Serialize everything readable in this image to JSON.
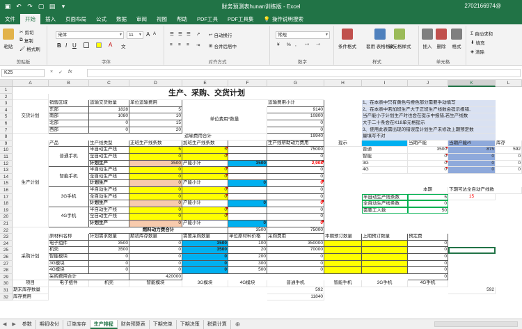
{
  "window": {
    "title": "财务预测表hunan训练版 - Excel",
    "user": "2702166974@",
    "quick_access": [
      "save-icon",
      "undo-icon",
      "redo-icon",
      "new-icon",
      "open-icon",
      "more-icon"
    ]
  },
  "ribbon_tabs": [
    "文件",
    "开始",
    "插入",
    "页面布局",
    "公式",
    "数据",
    "审阅",
    "视图",
    "帮助",
    "PDF工具",
    "PDF工具集",
    "操作说明搜索"
  ],
  "active_tab": "开始",
  "ribbon": {
    "clipboard": {
      "label": "剪贴板",
      "paste": "粘贴",
      "cut": "剪切",
      "copy": "复制",
      "format_painter": "格式刷"
    },
    "font": {
      "label": "字体",
      "name": "宋体",
      "size": "11",
      "grow": "A",
      "shrink": "A",
      "bold": "B",
      "italic": "I",
      "underline": "U",
      "phonetic": "文"
    },
    "alignment": {
      "label": "对齐方式",
      "wrap": "自动换行",
      "merge": "合并后居中"
    },
    "number": {
      "label": "数字",
      "format": "常规",
      "percent": "%",
      "comma": ","
    },
    "styles": {
      "label": "样式",
      "conditional": "条件格式",
      "table": "套用\n表格格式",
      "cell_styles": "单元格样式"
    },
    "cells": {
      "label": "单元格",
      "insert": "插入",
      "delete": "删除",
      "format": "格式"
    },
    "editing": {
      "autosum": "自动求和",
      "fill": "填充",
      "clear": "清除"
    }
  },
  "formula_bar": {
    "name_box": "K25",
    "cancel": "×",
    "enter": "✓",
    "fx": "fx",
    "value": ""
  },
  "columns": [
    "A",
    "B",
    "C",
    "D",
    "E",
    "F",
    "G",
    "H",
    "I",
    "J",
    "K",
    "L"
  ],
  "selected_column": "K",
  "rows": [
    "1",
    "2",
    "3",
    "4",
    "5",
    "6",
    "7",
    "8",
    "9",
    "10",
    "11",
    "12",
    "13",
    "14",
    "15",
    "16",
    "17",
    "18",
    "19",
    "20",
    "21",
    "22",
    "23",
    "24",
    "25",
    "26",
    "27",
    "28",
    "29",
    "30",
    "31",
    "32"
  ],
  "sheet": {
    "title": "生产、采购、交货计划",
    "sections": {
      "delivery": "交货计划",
      "production": "生产计划",
      "procurement": "采购计划"
    },
    "delivery": {
      "headers": [
        "销售区域",
        "运输交货数量",
        "单位运输费用"
      ],
      "rows": [
        {
          "area": "东部",
          "qty": "1828",
          "cost": "5"
        },
        {
          "area": "南部",
          "qty": "1080",
          "cost": "10"
        },
        {
          "area": "北部",
          "qty": "0",
          "cost": "15"
        },
        {
          "area": "西部",
          "qty": "0",
          "cost": "20"
        }
      ],
      "unit_label": "单位费用*数量",
      "subtotal_header": "运输费用小计",
      "subtotals": [
        "9140",
        "10800",
        "0",
        "0"
      ],
      "total_label": "运输费用合计",
      "total": "19940"
    },
    "production": {
      "headers": [
        "产品",
        "生产线类型",
        "正班生产线条数",
        "加班生产线条数",
        "生产线帮助动力费用"
      ],
      "products": [
        {
          "name": "普通手机",
          "lines": [
            {
              "type": "半自动生产线",
              "regular": "5",
              "overtime": "5",
              "power": "75000"
            },
            {
              "type": "全自动生产线",
              "regular": "0",
              "overtime": "0",
              "power": "0"
            }
          ],
          "plan": "3500",
          "sub": "3500",
          "sub2": "2,908"
        },
        {
          "name": "智能手机",
          "lines": [
            {
              "type": "半自动生产线",
              "regular": "0",
              "overtime": "0",
              "power": "0"
            },
            {
              "type": "全自动生产线",
              "regular": "0",
              "overtime": "0",
              "power": "0"
            }
          ],
          "plan": "0",
          "sub": "0",
          "sub2": "0"
        },
        {
          "name": "3G手机",
          "lines": [
            {
              "type": "半自动生产线",
              "regular": "0",
              "overtime": "0",
              "power": "0"
            },
            {
              "type": "全自动生产线",
              "regular": "0",
              "overtime": "0",
              "power": "0"
            }
          ],
          "plan": "0",
          "sub": "0",
          "sub2": "0"
        },
        {
          "name": "4G手机",
          "lines": [
            {
              "type": "半自动生产线",
              "regular": "0",
              "overtime": "0",
              "power": "0"
            },
            {
              "type": "全自动生产线",
              "regular": "0",
              "overtime": "0",
              "power": "0"
            }
          ],
          "plan": "0",
          "sub": "0",
          "sub2": "0"
        }
      ],
      "plan_label": "计划生产",
      "subtotal_label": "产能小计",
      "fuel_total_label": "燃料动力费合计",
      "fuel_total_value": "3500",
      "fuel_total_cost": "75000"
    },
    "procurement": {
      "headers": [
        "原材料名称",
        "计划需求数量",
        "期初库存数量",
        "需要采购数量",
        "单位原材料价格",
        "采购费用",
        "本期预订数量",
        "上期预订数量",
        "预定费"
      ],
      "rows": [
        {
          "name": "电子组件",
          "need": "3500",
          "stock": "0",
          "buy": "3500",
          "price": "100",
          "cost": "350000",
          "pre": "0"
        },
        {
          "name": "机壳",
          "need": "3500",
          "stock": "0",
          "buy": "3500",
          "price": "20",
          "cost": "70000",
          "pre": "0"
        },
        {
          "name": "智能模块",
          "need": "0",
          "stock": "0",
          "buy": "0",
          "price": "200",
          "cost": "0",
          "pre": "0"
        },
        {
          "name": "3G模块",
          "need": "0",
          "stock": "0",
          "buy": "0",
          "price": "300",
          "cost": "0",
          "pre": "0"
        },
        {
          "name": "4G模块",
          "need": "0",
          "stock": "0",
          "buy": "0",
          "price": "500",
          "cost": "0",
          "pre": "0"
        }
      ],
      "total_label": "采购费用合计",
      "total": "420000",
      "total_pre": "0"
    },
    "bottom": {
      "headers": [
        "项目",
        "电子组件",
        "机壳",
        "智能模块",
        "3G模块",
        "4G模块",
        "普通手机",
        "智能手机",
        "3G手机",
        "4G手机"
      ],
      "row31": {
        "label": "期末库存数量",
        "value_g": "592",
        "value_l": "592"
      },
      "row32": {
        "label": "库存费用",
        "value_g": "11840"
      }
    },
    "notes": [
      "1、在本表中只有黄色与橙色部分需要手动填写",
      "2、在本表中若加班生产大于正班生产线数会提示报错,",
      "当产能小于计划生产时也会在提示中报错,若生产线数",
      "大于二十条会在K18单元格提示",
      "3、使用此表需出现的错误是计划生产未修改上期预定数",
      "量填写不对"
    ],
    "prompt_label": "提示",
    "capacity": {
      "header1": "当期产能",
      "header2": "当期产能/4",
      "header3": "库存",
      "rows": [
        {
          "name": "普通",
          "cap": "3500",
          "cap4": "875",
          "stock": "592"
        },
        {
          "name": "智能",
          "cap": "0",
          "cap4": "0",
          "stock": "0"
        },
        {
          "name": "3G",
          "cap": "0",
          "cap4": "0",
          "stock": "0"
        },
        {
          "name": "4G",
          "cap": "0",
          "cap4": "0",
          "stock": "0"
        }
      ]
    },
    "period": {
      "this": "本期",
      "next": "下期可达全自动产线数",
      "next_value": "15",
      "rows": [
        {
          "label": "半自动生产线条数",
          "value": "5"
        },
        {
          "label": "全自动生产线条数",
          "value": "0"
        },
        {
          "label": "需要工人数",
          "value": "50"
        }
      ]
    }
  },
  "sheet_tabs": [
    "参数",
    "期初收付",
    "订单库存",
    "生产排程",
    "财务预算表",
    "下期完单",
    "下期决策",
    "税费计算"
  ],
  "active_sheet": "生产排程"
}
